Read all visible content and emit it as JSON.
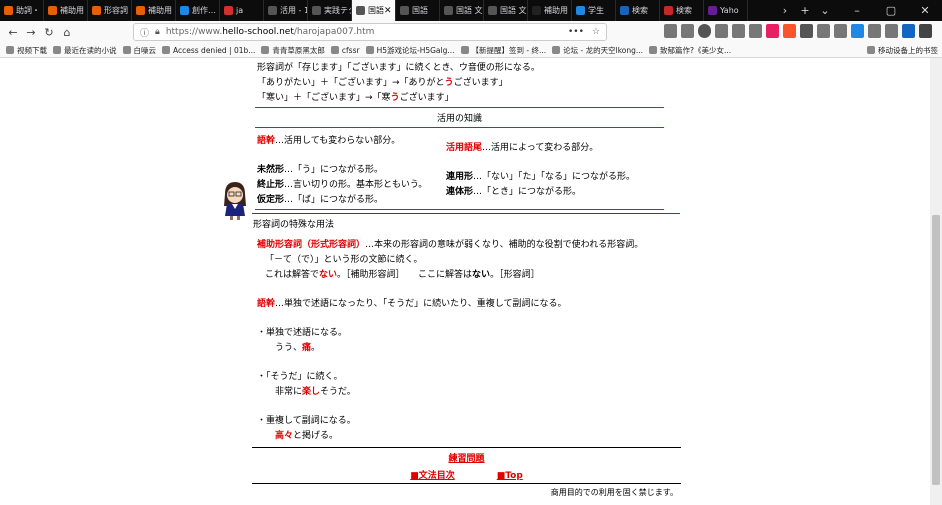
{
  "browser": {
    "tabs": [
      {
        "label": "助詞・",
        "favicon_color": "#e66000"
      },
      {
        "label": "補助用",
        "favicon_color": "#e66000"
      },
      {
        "label": "形容詞",
        "favicon_color": "#e66000"
      },
      {
        "label": "補助用",
        "favicon_color": "#e66000"
      },
      {
        "label": "創作…",
        "favicon_color": "#1e88e5"
      },
      {
        "label": "ja",
        "favicon_color": "#d32f2f"
      },
      {
        "label": "活用 - 10",
        "favicon_color": "#555555"
      },
      {
        "label": "実践テク",
        "favicon_color": "#555555"
      },
      {
        "label": "国語",
        "favicon_color": "#555555",
        "active": true
      },
      {
        "label": "国語",
        "favicon_color": "#555555"
      },
      {
        "label": "国語 文",
        "favicon_color": "#555555"
      },
      {
        "label": "国語 文",
        "favicon_color": "#555555"
      },
      {
        "label": "補助用",
        "favicon_color": "#222222"
      },
      {
        "label": "学生",
        "favicon_color": "#1e88e5"
      },
      {
        "label": "検索",
        "favicon_color": "#1565c0"
      },
      {
        "label": "検索",
        "favicon_color": "#c62828"
      },
      {
        "label": "Yaho",
        "favicon_color": "#6a1b9a"
      }
    ],
    "url_prefix": "https://www.",
    "url_host": "hello-school.net",
    "url_path": "/harojapa007.htm",
    "url_menu": "•••",
    "bookmarks": [
      "视频下载",
      "最近在读的小说",
      "白噪云",
      "Access denied | 01b...",
      "青青草原黑太郎",
      "cfssr",
      "H5游戏论坛-H5Galg...",
      "【新提醒】签到 - 终...",
      "论坛 - 龙的天空lkong...",
      "致郁篇作?《美少女...",
      "移动设备上的书签"
    ]
  },
  "page": {
    "intro_lines": [
      "形容詞が「存じます」「ございます」に続くとき、ウ音便の形になる。",
      "「ありがたい」＋「ございます」→「ありがとうございます」",
      "「寒い」＋「ございます」→「寒うございます」"
    ],
    "intro_highlight_1": "う",
    "intro_highlight_2": "う",
    "section_title": "活用の知識",
    "gokan_term": "語幹",
    "gokan_desc": "…活用しても変わらない部分。",
    "gobi_term": "活用語尾",
    "gobi_desc": "…活用によって変わる部分。",
    "mizen": {
      "term": "未然形",
      "desc": "…「う」につながる形。"
    },
    "shushi": {
      "term": "終止形",
      "desc": "…言い切りの形。基本形ともいう。"
    },
    "katei": {
      "term": "仮定形",
      "desc": "…「ば」につながる形。"
    },
    "renyo": {
      "term": "連用形",
      "desc": "…「ない」「た」「なる」につながる形。"
    },
    "rentai": {
      "term": "連体形",
      "desc": "…「とき」につながる形。"
    },
    "special_title": "形容詞の特殊な用法",
    "hojo_term": "補助形容詞（形式形容詞）",
    "hojo_desc": "…本来の形容詞の意味が弱くなり、補助的な役割で使われる形容詞。",
    "hojo_line2": "「－て（で）」という形の文節に続く。",
    "hojo_ex_a": "これは解答で",
    "hojo_ex_nai1": "ない",
    "hojo_ex_b": "。［補助形容詞］　　ここに解答は",
    "hojo_ex_nai2": "ない",
    "hojo_ex_c": "。［形容詞］",
    "gokan2_term": "語幹",
    "gokan2_desc": "…単独で述語になったり、「そうだ」に続いたり、重複して副詞になる。",
    "u1": "・単独で述語になる。",
    "u1_ex_a": "うう、",
    "u1_ex_red": "痛",
    "u1_ex_b": "。",
    "u2": "・「そうだ」に続く。",
    "u2_ex_a": "非常に",
    "u2_ex_red": "楽し",
    "u2_ex_b": "そうだ。",
    "u3": "・重複して副詞になる。",
    "u3_ex_red": "高々",
    "u3_ex_b": "と掲げる。",
    "practice_link": "練習問題",
    "toc_link": "■文法目次",
    "top_link": "■Top",
    "footer": "商用目的での利用を固く禁じます。"
  }
}
